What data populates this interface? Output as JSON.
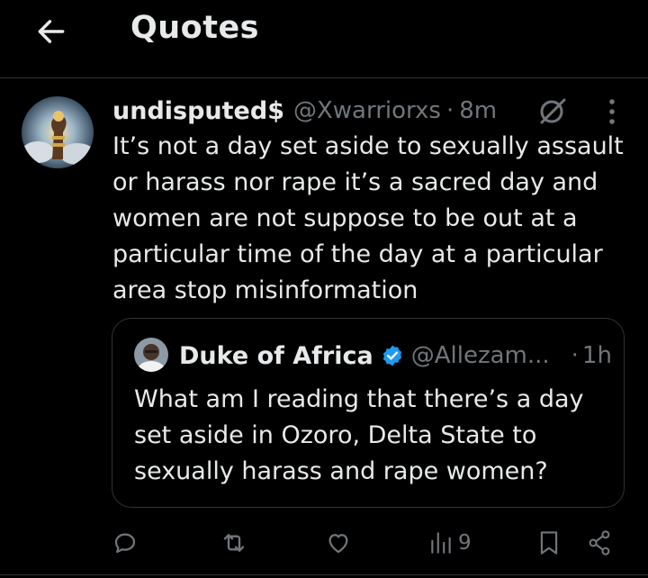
{
  "header": {
    "title": "Quotes",
    "back_icon": "arrow-left-icon"
  },
  "tweet": {
    "display_name": "undisputed$",
    "handle": "@Xwarriorxs",
    "separator": "·",
    "time": "8m",
    "text": "It’s not a day set aside to sexually assault or harass nor rape it’s a sacred day and women are not suppose to be out at a particular time of the day at a particular area stop misinformation",
    "quoted": {
      "display_name": "Duke of Africa",
      "handle": "@Allezam...",
      "separator": "·",
      "time": "1h",
      "verified": true,
      "text": "What am I reading that there’s a day set aside in Ozoro, Delta State to sexually harass and rape women?"
    },
    "actions": {
      "reply_icon": "reply-icon",
      "repost_icon": "repost-icon",
      "like_icon": "heart-icon",
      "views_icon": "views-chart-icon",
      "views_count": "9",
      "bookmark_icon": "bookmark-icon",
      "share_icon": "share-icon"
    }
  },
  "colors": {
    "background": "#000000",
    "text_primary": "#e7e9ea",
    "text_secondary": "#71767b",
    "border": "#2f3336",
    "verified_blue": "#1d9bf0"
  }
}
